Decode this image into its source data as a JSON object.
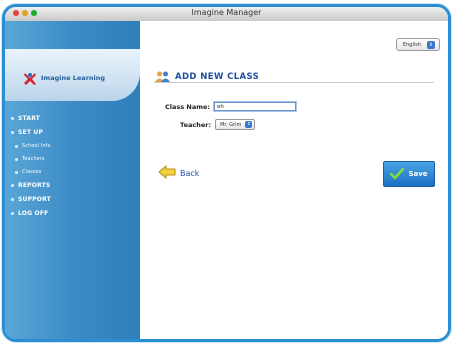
{
  "window": {
    "title": "Imagine Manager"
  },
  "brand": {
    "name": "Imagine Learning"
  },
  "nav": {
    "items": [
      {
        "label": "START",
        "type": "main"
      },
      {
        "label": "SET UP",
        "type": "main"
      },
      {
        "label": "School Info",
        "type": "sub"
      },
      {
        "label": "Teachers",
        "type": "sub"
      },
      {
        "label": "Classes",
        "type": "sub"
      },
      {
        "label": "REPORTS",
        "type": "main"
      },
      {
        "label": "SUPPORT",
        "type": "main"
      },
      {
        "label": "LOG OFF",
        "type": "main"
      }
    ]
  },
  "language": {
    "selected": "English"
  },
  "page": {
    "title": "ADD NEW CLASS"
  },
  "form": {
    "class_name_label": "Class Name:",
    "class_name_value": "eh",
    "teacher_label": "Teacher:",
    "teacher_value": "Mr. Grim"
  },
  "actions": {
    "back_label": "Back",
    "save_label": "Save"
  },
  "colors": {
    "frame": "#2a8fd2",
    "sidebar": "#3c8bc6",
    "heading": "#1f4d9e",
    "save": "#1d6fc3"
  }
}
